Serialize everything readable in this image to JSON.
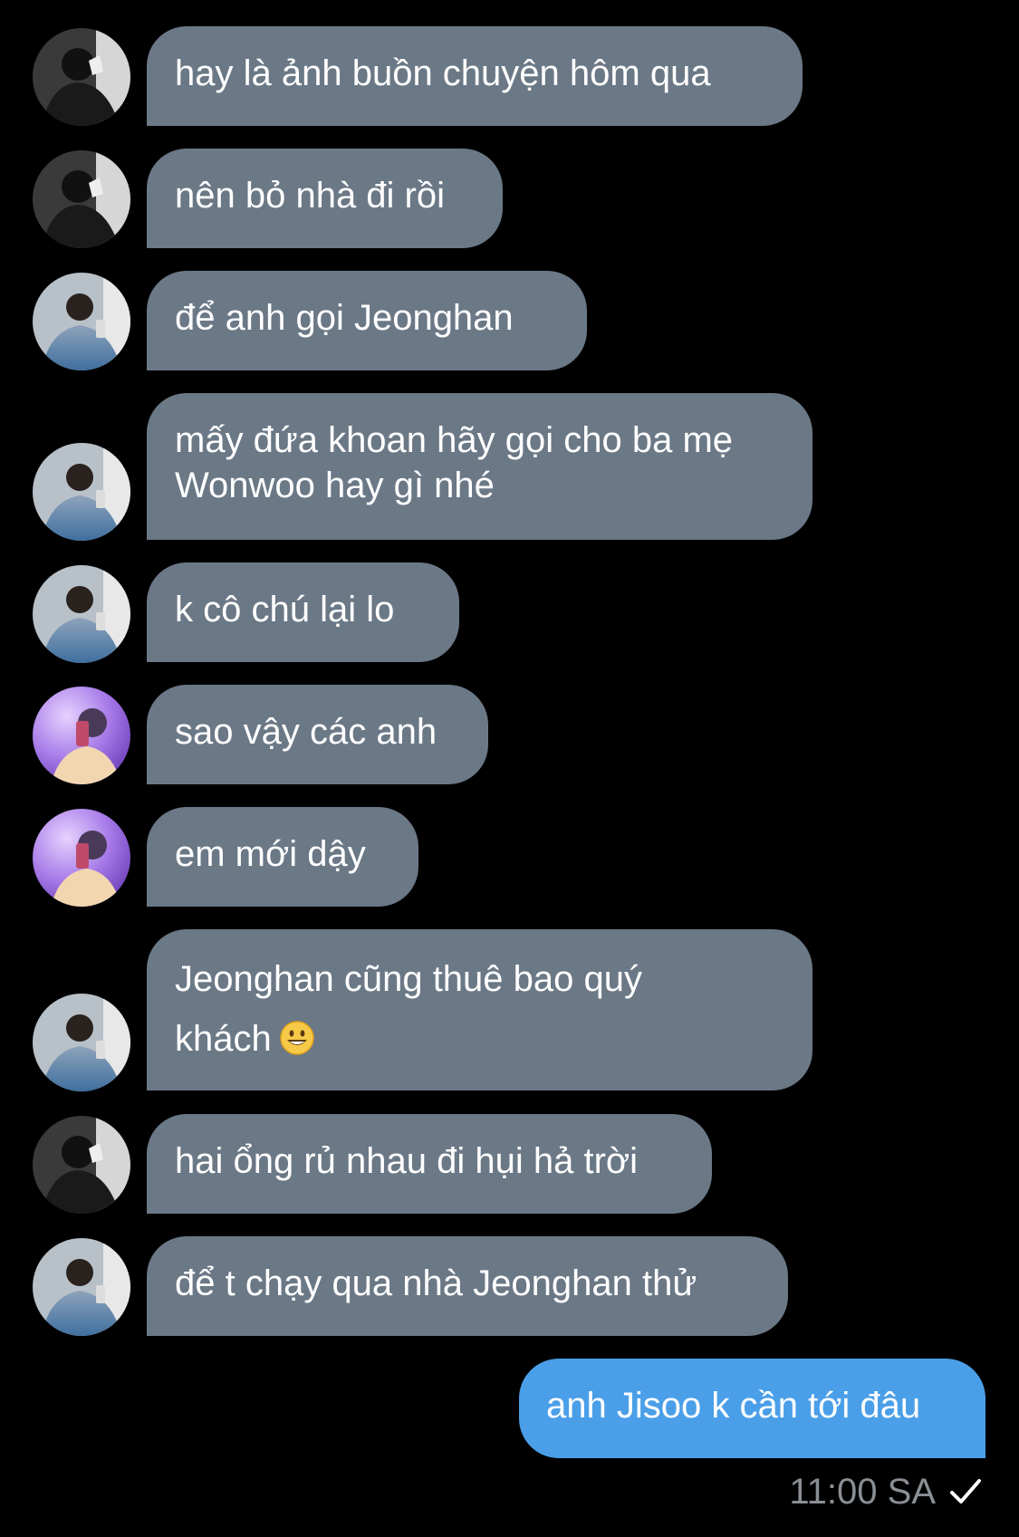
{
  "messages": [
    {
      "sender": "dark",
      "text": "hay là ảnh buồn chuyện hôm qua"
    },
    {
      "sender": "dark",
      "text": "nên bỏ nhà đi rồi"
    },
    {
      "sender": "denim",
      "text": "để anh gọi Jeonghan"
    },
    {
      "sender": "denim",
      "text": "mấy đứa khoan hãy gọi cho ba mẹ\nWonwoo hay gì nhé"
    },
    {
      "sender": "denim",
      "text": "k cô chú lại lo"
    },
    {
      "sender": "purple",
      "text": "sao vậy các anh"
    },
    {
      "sender": "purple",
      "text": "em mới dậy"
    },
    {
      "sender": "denim",
      "text": "Jeonghan cũng thuê bao quý\nkhách",
      "emoji": "smiley-face-emoji"
    },
    {
      "sender": "dark",
      "text": "hai ổng rủ nhau đi hụi hả trời"
    },
    {
      "sender": "denim",
      "text": "để t chạy qua nhà Jeonghan thử"
    }
  ],
  "outgoing": {
    "text": "anh Jisoo k cần tới đâu",
    "time": "11:00 SA",
    "status_icon": "single-check-icon"
  },
  "colors": {
    "incoming_bubble": "#6b7886",
    "outgoing_bubble": "#4a9fe8",
    "background": "#000000",
    "meta_text": "#8a8f95"
  }
}
